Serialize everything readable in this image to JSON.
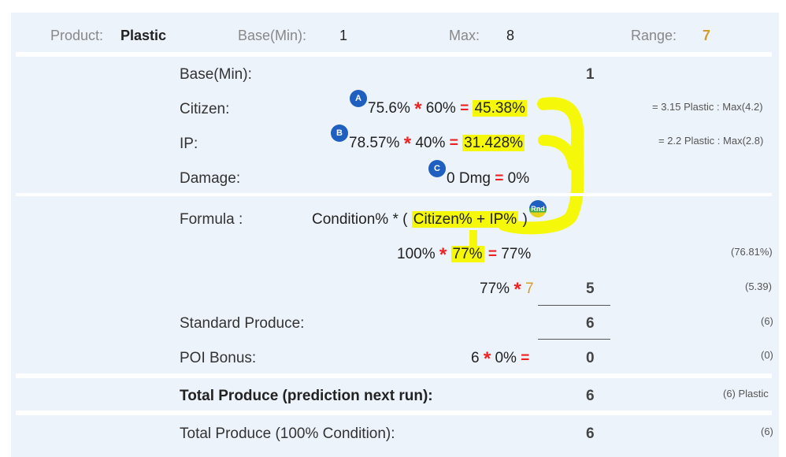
{
  "header": {
    "product_label": "Product:",
    "product_value": "Plastic",
    "base_label": "Base(Min):",
    "base_value": "1",
    "max_label": "Max:",
    "max_value": "8",
    "range_label": "Range:",
    "range_value": "7"
  },
  "rows": {
    "base": {
      "label": "Base(Min):",
      "value": "1"
    },
    "citizen": {
      "label": "Citizen:",
      "badge": "A",
      "a": "75.6%",
      "b": "60%",
      "result": "45.38%",
      "note": "= 3.15 Plastic : Max(4.2)"
    },
    "ip": {
      "label": "IP:",
      "badge": "B",
      "a": "78.57%",
      "b": "40%",
      "result": "31.428%",
      "note": "= 2.2 Plastic : Max(2.8)"
    },
    "damage": {
      "label": "Damage:",
      "badge": "C",
      "a": "0 Dmg",
      "result": "0%"
    },
    "formula": {
      "label": "Formula :",
      "prefix": "Condition% * (",
      "highlight": "Citizen% + IP%",
      "suffix": ")",
      "badge": "Rnd"
    },
    "calc1": {
      "a": "100%",
      "b": "77%",
      "result": "77%",
      "note": "(76.81%)"
    },
    "calc2": {
      "a": "77%",
      "b": "7",
      "value": "5",
      "note": "(5.39)"
    },
    "standard": {
      "label": "Standard Produce:",
      "value": "6",
      "note": "(6)"
    },
    "poi": {
      "label": "POI Bonus:",
      "a": "6",
      "b": "0%",
      "value": "0",
      "note": "(0)"
    },
    "total_next": {
      "label": "Total Produce (prediction next run):",
      "value": "6",
      "note": "(6) Plastic"
    },
    "total_full": {
      "label": "Total Produce (100% Condition):",
      "value": "6",
      "note": "(6)"
    }
  },
  "symbols": {
    "times": "*",
    "equals": "="
  },
  "colors": {
    "highlight": "#f6f80a",
    "operator": "#ee2222",
    "accent": "#d39d2e",
    "badge": "#1f5fbf"
  }
}
